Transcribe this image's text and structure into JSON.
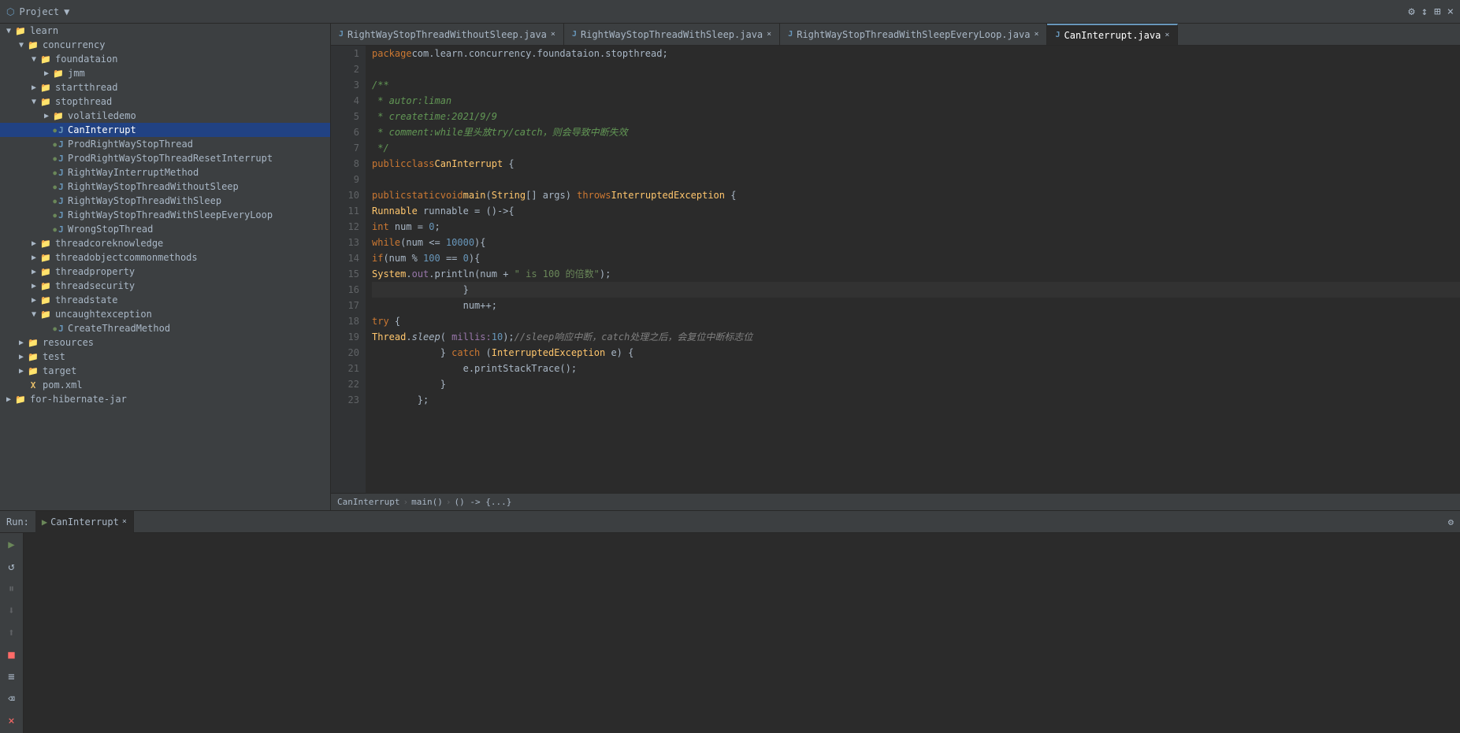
{
  "topbar": {
    "project_label": "Project",
    "actions": [
      "⚙",
      "↕",
      "⊞",
      "×"
    ]
  },
  "sidebar": {
    "items": [
      {
        "id": "learn",
        "label": "learn",
        "level": 0,
        "type": "dir",
        "expanded": true,
        "arrow": "▼"
      },
      {
        "id": "concurrency",
        "label": "concurrency",
        "level": 1,
        "type": "dir",
        "expanded": true,
        "arrow": "▼"
      },
      {
        "id": "foundataion",
        "label": "foundataion",
        "level": 2,
        "type": "package",
        "expanded": true,
        "arrow": "▼"
      },
      {
        "id": "jmm",
        "label": "jmm",
        "level": 3,
        "type": "dir",
        "expanded": false,
        "arrow": "▶"
      },
      {
        "id": "startthread",
        "label": "startthread",
        "level": 2,
        "type": "dir",
        "expanded": false,
        "arrow": "▶"
      },
      {
        "id": "stopthread",
        "label": "stopthread",
        "level": 2,
        "type": "dir",
        "expanded": true,
        "arrow": "▼"
      },
      {
        "id": "volatiledemo",
        "label": "volatiledemo",
        "level": 3,
        "type": "dir",
        "expanded": false,
        "arrow": "▶"
      },
      {
        "id": "CanInterrupt",
        "label": "CanInterrupt",
        "level": 3,
        "type": "java",
        "expanded": false,
        "arrow": "",
        "selected": true
      },
      {
        "id": "ProdRightWayStopThread",
        "label": "ProdRightWayStopThread",
        "level": 3,
        "type": "java",
        "expanded": false,
        "arrow": ""
      },
      {
        "id": "ProdRightWayStopThreadResetInterrupt",
        "label": "ProdRightWayStopThreadResetInterrupt",
        "level": 3,
        "type": "java",
        "expanded": false,
        "arrow": ""
      },
      {
        "id": "RightWayInterruptMethod",
        "label": "RightWayInterruptMethod",
        "level": 3,
        "type": "java",
        "expanded": false,
        "arrow": ""
      },
      {
        "id": "RightWayStopThreadWithoutSleep",
        "label": "RightWayStopThreadWithoutSleep",
        "level": 3,
        "type": "java",
        "expanded": false,
        "arrow": ""
      },
      {
        "id": "RightWayStopThreadWithSleep",
        "label": "RightWayStopThreadWithSleep",
        "level": 3,
        "type": "java",
        "expanded": false,
        "arrow": ""
      },
      {
        "id": "RightWayStopThreadWithSleepEveryLoop",
        "label": "RightWayStopThreadWithSleepEveryLoop",
        "level": 3,
        "type": "java",
        "expanded": false,
        "arrow": ""
      },
      {
        "id": "WrongStopThread",
        "label": "WrongStopThread",
        "level": 3,
        "type": "java",
        "expanded": false,
        "arrow": ""
      },
      {
        "id": "threadcoreknowledge",
        "label": "threadcoreknowledge",
        "level": 2,
        "type": "dir",
        "expanded": false,
        "arrow": "▶"
      },
      {
        "id": "threadobjectcommonmethods",
        "label": "threadobjectcommonmethods",
        "level": 2,
        "type": "dir",
        "expanded": false,
        "arrow": "▶"
      },
      {
        "id": "threadproperty",
        "label": "threadproperty",
        "level": 2,
        "type": "dir",
        "expanded": false,
        "arrow": "▶"
      },
      {
        "id": "threadsecurity",
        "label": "threadsecurity",
        "level": 2,
        "type": "dir",
        "expanded": false,
        "arrow": "▶"
      },
      {
        "id": "threadstate",
        "label": "threadstate",
        "level": 2,
        "type": "dir",
        "expanded": false,
        "arrow": "▶"
      },
      {
        "id": "uncaughtexception",
        "label": "uncaughtexception",
        "level": 2,
        "type": "dir",
        "expanded": true,
        "arrow": "▼"
      },
      {
        "id": "CreateThreadMethod",
        "label": "CreateThreadMethod",
        "level": 3,
        "type": "java",
        "expanded": false,
        "arrow": ""
      },
      {
        "id": "resources",
        "label": "resources",
        "level": 1,
        "type": "dir",
        "expanded": false,
        "arrow": "▶"
      },
      {
        "id": "test",
        "label": "test",
        "level": 1,
        "type": "dir",
        "expanded": false,
        "arrow": "▶"
      },
      {
        "id": "target",
        "label": "target",
        "level": 1,
        "type": "dir",
        "expanded": false,
        "arrow": "▶"
      },
      {
        "id": "pom.xml",
        "label": "pom.xml",
        "level": 1,
        "type": "xml",
        "expanded": false,
        "arrow": ""
      },
      {
        "id": "for-hibernate-jar",
        "label": "for-hibernate-jar",
        "level": 0,
        "type": "dir",
        "expanded": false,
        "arrow": "▶"
      }
    ]
  },
  "tabs": [
    {
      "id": "RightWayStopThreadWithoutSleep",
      "label": "RightWayStopThreadWithoutSleep.java",
      "active": false,
      "closeable": true
    },
    {
      "id": "RightWayStopThreadWithSleep",
      "label": "RightWayStopThreadWithSleep.java",
      "active": false,
      "closeable": true
    },
    {
      "id": "RightWayStopThreadWithSleepEveryLoop",
      "label": "RightWayStopThreadWithSleepEveryLoop.java",
      "active": false,
      "closeable": true
    },
    {
      "id": "CanInterrupt",
      "label": "CanInterrupt.java",
      "active": true,
      "closeable": true
    }
  ],
  "code": {
    "package_line": "package com.learn.concurrency.foundataion.stopthread;",
    "lines": [
      {
        "num": 1,
        "content": "package com.learn.concurrency.foundataion.stopthread;",
        "run": false,
        "bp": false
      },
      {
        "num": 2,
        "content": "",
        "run": false,
        "bp": false
      },
      {
        "num": 3,
        "content": "/**",
        "run": false,
        "bp": false
      },
      {
        "num": 4,
        "content": " * autor:liman",
        "run": false,
        "bp": false
      },
      {
        "num": 5,
        "content": " * createtime:2021/9/9",
        "run": false,
        "bp": false
      },
      {
        "num": 6,
        "content": " * comment:while里头放try/catch，则会导致中断失效",
        "run": false,
        "bp": false
      },
      {
        "num": 7,
        "content": " */",
        "run": false,
        "bp": false
      },
      {
        "num": 8,
        "content": "public class CanInterrupt {",
        "run": true,
        "bp": false
      },
      {
        "num": 9,
        "content": "",
        "run": false,
        "bp": false
      },
      {
        "num": 10,
        "content": "    public static void main(String[] args) throws InterruptedException {",
        "run": true,
        "bp": false
      },
      {
        "num": 11,
        "content": "        Runnable runnable = ()->{",
        "run": false,
        "bp": true
      },
      {
        "num": 12,
        "content": "            int num = 0;",
        "run": false,
        "bp": false
      },
      {
        "num": 13,
        "content": "            while(num <= 10000){",
        "run": false,
        "bp": false
      },
      {
        "num": 14,
        "content": "                if(num % 100 == 0){",
        "run": false,
        "bp": false
      },
      {
        "num": 15,
        "content": "                    System.out.println(num + \" is 100 的倍数\");",
        "run": false,
        "bp": false
      },
      {
        "num": 16,
        "content": "                }",
        "run": false,
        "bp": false,
        "highlighted": true
      },
      {
        "num": 17,
        "content": "                num++;",
        "run": false,
        "bp": false
      },
      {
        "num": 18,
        "content": "            try {",
        "run": false,
        "bp": false
      },
      {
        "num": 19,
        "content": "                Thread.sleep( millis: 10);//sleep响应中断，catch处理之后，会复位中断标志位",
        "run": false,
        "bp": false
      },
      {
        "num": 20,
        "content": "            } catch (InterruptedException e) {",
        "run": false,
        "bp": false
      },
      {
        "num": 21,
        "content": "                e.printStackTrace();",
        "run": false,
        "bp": false
      },
      {
        "num": 22,
        "content": "            }",
        "run": false,
        "bp": false
      },
      {
        "num": 23,
        "content": "        };",
        "run": false,
        "bp": false
      }
    ]
  },
  "breadcrumb": {
    "parts": [
      "CanInterrupt",
      "main()",
      "() -> {...}"
    ]
  },
  "run_panel": {
    "run_label": "Run:",
    "tab_label": "CanInterrupt",
    "close_label": "×",
    "tools": [
      {
        "icon": "▶",
        "tooltip": "Run",
        "disabled": false
      },
      {
        "icon": "⟳",
        "tooltip": "Rerun",
        "disabled": false
      },
      {
        "icon": "⏸",
        "tooltip": "Pause",
        "disabled": false
      },
      {
        "icon": "⏬",
        "tooltip": "Step",
        "disabled": false
      },
      {
        "icon": "⏫",
        "tooltip": "Step Up",
        "disabled": false
      },
      {
        "icon": "🔴",
        "tooltip": "Stop",
        "disabled": false
      },
      {
        "icon": "📋",
        "tooltip": "Copy",
        "disabled": false
      },
      {
        "icon": "🗑",
        "tooltip": "Clear",
        "disabled": false
      },
      {
        "icon": "×",
        "tooltip": "Close",
        "disabled": false
      }
    ]
  }
}
